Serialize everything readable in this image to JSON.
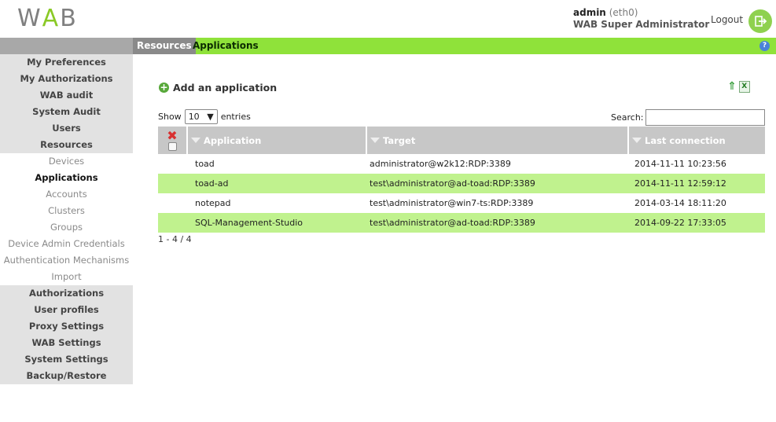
{
  "header": {
    "logo_left": "W",
    "logo_a": "A",
    "logo_right": "B",
    "user_name": "admin",
    "user_iface": "(eth0)",
    "user_role": "WAB Super Administrator",
    "logout_label": "Logout"
  },
  "breadcrumb": {
    "resources": "Resources",
    "applications": "Applications",
    "help": "?"
  },
  "sidebar": {
    "items": [
      {
        "label": "My Preferences",
        "type": "main"
      },
      {
        "label": "My Authorizations",
        "type": "main"
      },
      {
        "label": "WAB audit",
        "type": "main"
      },
      {
        "label": "System Audit",
        "type": "main"
      },
      {
        "label": "Users",
        "type": "main"
      },
      {
        "label": "Resources",
        "type": "main"
      },
      {
        "label": "Devices",
        "type": "sub"
      },
      {
        "label": "Applications",
        "type": "active"
      },
      {
        "label": "Accounts",
        "type": "sub"
      },
      {
        "label": "Clusters",
        "type": "sub"
      },
      {
        "label": "Groups",
        "type": "sub"
      },
      {
        "label": "Device Admin Credentials",
        "type": "sub"
      },
      {
        "label": "Authentication Mechanisms",
        "type": "sub"
      },
      {
        "label": "Import",
        "type": "sub"
      },
      {
        "label": "Authorizations",
        "type": "main"
      },
      {
        "label": "User profiles",
        "type": "main"
      },
      {
        "label": "Proxy Settings",
        "type": "main"
      },
      {
        "label": "WAB Settings",
        "type": "main"
      },
      {
        "label": "System Settings",
        "type": "main"
      },
      {
        "label": "Backup/Restore",
        "type": "main"
      }
    ]
  },
  "content": {
    "add_label": "Add an application",
    "show_label": "Show",
    "entries_value": "10",
    "entries_label": "entries",
    "search_label": "Search:",
    "search_value": "",
    "columns": [
      "Application",
      "Target",
      "Last connection"
    ],
    "rows": [
      {
        "application": "toad",
        "target": "administrator@w2k12:RDP:3389",
        "last": "2014-11-11 10:23:56"
      },
      {
        "application": "toad-ad",
        "target": "test\\administrator@ad-toad:RDP:3389",
        "last": "2014-11-11 12:59:12"
      },
      {
        "application": "notepad",
        "target": "test\\administrator@win7-ts:RDP:3389",
        "last": "2014-03-14 18:11:20"
      },
      {
        "application": "SQL-Management-Studio",
        "target": "test\\administrator@ad-toad:RDP:3389",
        "last": "2014-09-22 17:33:05"
      }
    ],
    "info": "1 - 4 / 4"
  },
  "colors": {
    "accent_green": "#8fe23a",
    "row_highlight": "#c0f28e",
    "header_gray": "#c7c7c7"
  },
  "icons": {
    "add": "plus-circle-icon",
    "delete": "x-icon",
    "logout": "logout-icon",
    "help": "help-icon",
    "export": "excel-export-icon"
  }
}
